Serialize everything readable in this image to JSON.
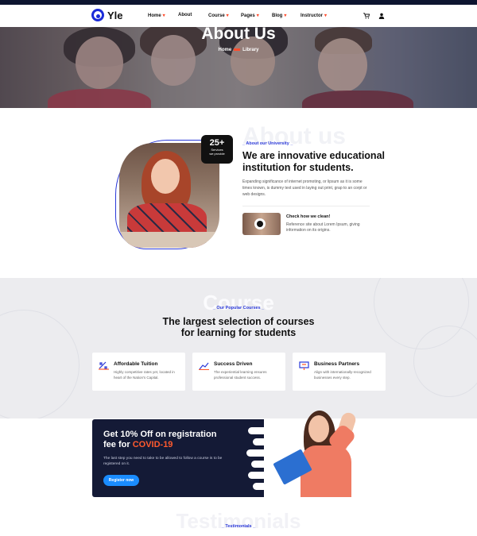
{
  "nav": {
    "logo_text": "Yle",
    "items": [
      {
        "label": "Home",
        "has_dropdown": true
      },
      {
        "label": "About",
        "has_dropdown": false
      },
      {
        "label": "Course",
        "has_dropdown": true
      },
      {
        "label": "Pages",
        "has_dropdown": true
      },
      {
        "label": "Blog",
        "has_dropdown": true
      },
      {
        "label": "Instructor",
        "has_dropdown": true
      }
    ],
    "dropdown_marker": "▾",
    "icons": [
      "cart-icon",
      "user-icon"
    ]
  },
  "hero": {
    "title": "About Us",
    "breadcrumb": {
      "home": "Home",
      "current": "Library"
    }
  },
  "about": {
    "bg_word": "About us",
    "badge_number": "25+",
    "badge_line1": "Services",
    "badge_line2": "we provide",
    "tagline": "About our University",
    "heading": "We are innovative educational institution for students.",
    "body": "Expanding significance of internet promoting, or lipsum as it is some times known, is dummy text used in laying out print, grap to an corpt or web designs.",
    "video": {
      "title": "Check how we clean!",
      "text": "Reference site about Lorem Ipsum, giving information on its origins."
    }
  },
  "courses": {
    "bg_word": "Course",
    "tagline": "Our Popular Courses",
    "heading_line1": "The largest selection of courses",
    "heading_line2": "for learning for students",
    "cards": [
      {
        "icon": "percent-tag-icon",
        "title": "Affordable Tuition",
        "text": "Highly competitive rates yet, located in heart of the Nation's Capital."
      },
      {
        "icon": "growth-chart-icon",
        "title": "Success Driven",
        "text": "The experiential learning ensures professional student success."
      },
      {
        "icon": "presentation-icon",
        "title": "Business Partners",
        "text": "Align with internationally-recognized businesses every step."
      }
    ]
  },
  "promo": {
    "title_line1": "Get 10% Off on registration",
    "title_line2_prefix": "fee for ",
    "title_highlight": "COVID-19",
    "body": "The last step you need to take to be allowed to follow a course is to be registered on it.",
    "button_label": "Register now"
  },
  "testimonials": {
    "bg_word": "Testimonials",
    "tagline": "Testimonials"
  },
  "colors": {
    "accent": "#2a38d8",
    "highlight": "#ff5a2e",
    "promo_bg": "#141a36",
    "button": "#1a8cff"
  }
}
